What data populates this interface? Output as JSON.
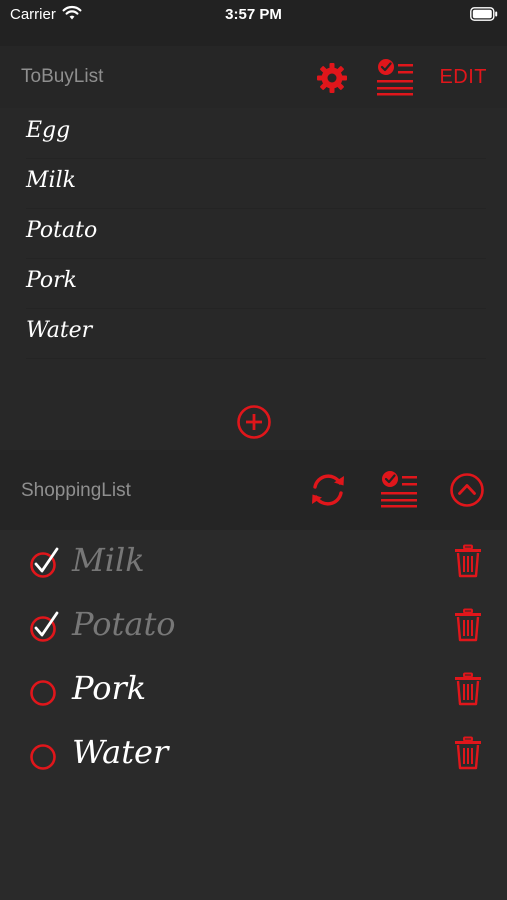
{
  "status_bar": {
    "carrier": "Carrier",
    "time": "3:57 PM"
  },
  "tobuy": {
    "title": "ToBuyList",
    "edit_label": "EDIT",
    "items": [
      "Egg",
      "Milk",
      "Potato",
      "Pork",
      "Water"
    ]
  },
  "shopping": {
    "title": "ShoppingList",
    "items": [
      {
        "label": "Milk",
        "checked": true
      },
      {
        "label": "Potato",
        "checked": true
      },
      {
        "label": "Pork",
        "checked": false
      },
      {
        "label": "Water",
        "checked": false
      }
    ]
  },
  "colors": {
    "accent": "#e0161b",
    "background": "#2a2a2a",
    "header_text": "#8f8f8f",
    "done_text": "#777777"
  },
  "icons": [
    "wifi-icon",
    "battery-icon",
    "gear-icon",
    "checklist-icon",
    "add-circle-icon",
    "refresh-icon",
    "chevron-up-circle-icon",
    "checkbox-icon",
    "trash-icon"
  ]
}
